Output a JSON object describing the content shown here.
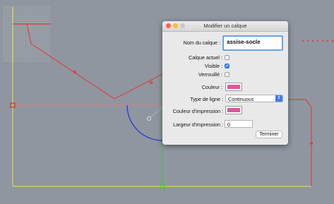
{
  "dialog": {
    "title": "Modifier un calque",
    "name_label": "Nom du calque :",
    "name_value": "assise-socle",
    "current_label": "Calque actuel :",
    "visible_label": "Visible :",
    "visible_checked": true,
    "locked_label": "Verrouillé :",
    "color_label": "Couleur :",
    "color_value": "#e0569b",
    "linetype_label": "Type de ligne :",
    "linetype_value": "Continuous",
    "printcolor_label": "Couleur d'impression :",
    "printcolor_value": "#e0569b",
    "printwidth_label": "Largeur d'impression :",
    "printwidth_value": "0",
    "done_button": "Terminer"
  },
  "canvas": {
    "background": "#8f969f",
    "accent_red": "#ef2a2a",
    "accent_yellow": "#e6e64a",
    "accent_green": "#2fd12f",
    "accent_blue": "#2f3fd9"
  }
}
